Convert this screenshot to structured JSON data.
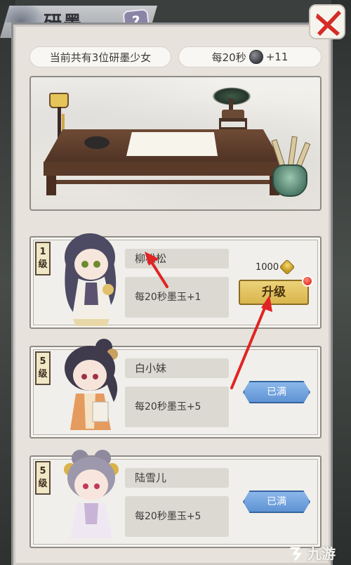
{
  "header": {
    "title": "研墨",
    "help_label": "?"
  },
  "info": {
    "girl_count_text": "当前共有3位研墨少女",
    "rate_prefix": "每20秒",
    "rate_suffix": "+11"
  },
  "cards": [
    {
      "level": "1",
      "level_unit": "级",
      "name": "柳松松",
      "rate": "每20秒墨玉+1",
      "cost": "1000",
      "action_label": "升级",
      "state": "upgrade"
    },
    {
      "level": "5",
      "level_unit": "级",
      "name": "白小妹",
      "rate": "每20秒墨玉+5",
      "action_label": "已满",
      "state": "max"
    },
    {
      "level": "5",
      "level_unit": "级",
      "name": "陆雪儿",
      "rate": "每20秒墨玉+5",
      "action_label": "已满",
      "state": "max"
    }
  ],
  "watermark": {
    "text": "九游"
  },
  "colors": {
    "panel_bg": "#e7e3dc",
    "upgrade_gold": "#d9b54c",
    "max_blue": "#5f93d4",
    "close_red": "#d62b26",
    "arrow_red": "#e02424"
  },
  "icons": {
    "close": "close-x-icon",
    "help": "question-icon",
    "ink_currency": "ink-jade-icon",
    "gold_currency": "gold-coin-icon",
    "watermark_logo": "jiuyou-logo-icon"
  }
}
